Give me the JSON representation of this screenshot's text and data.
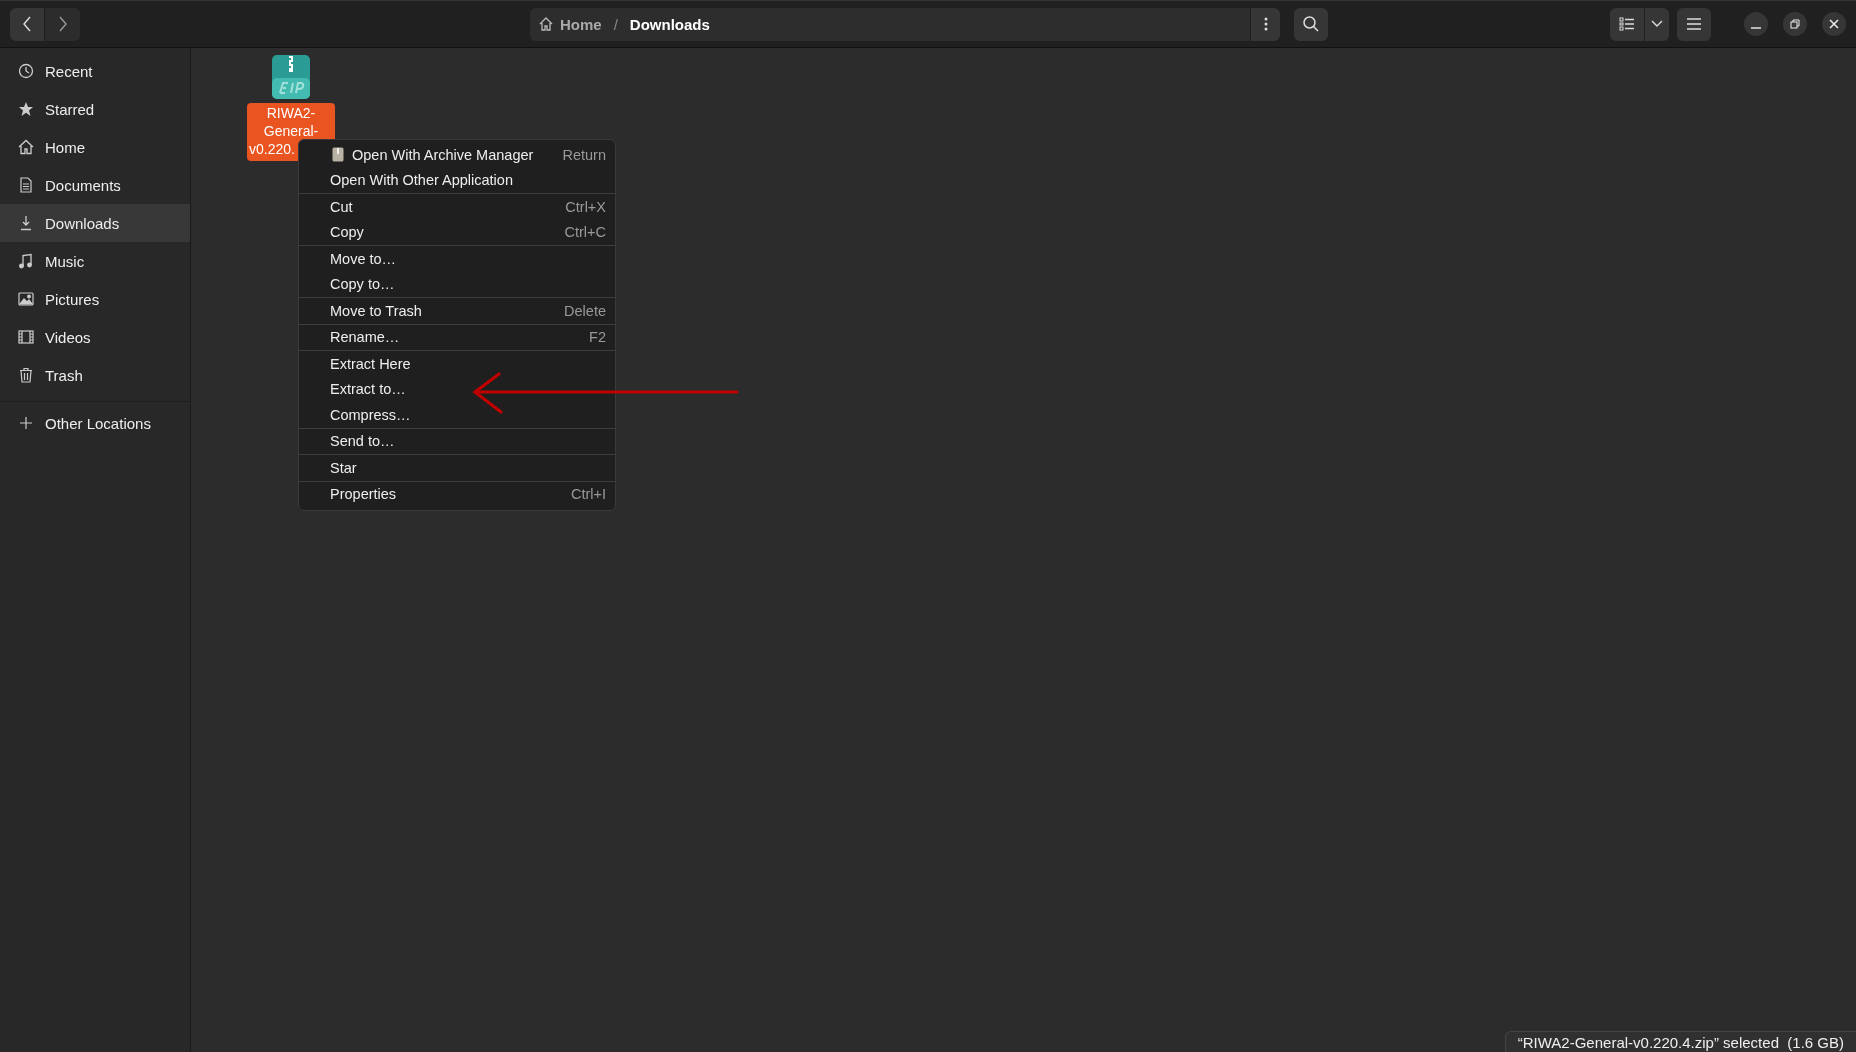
{
  "path_bar": {
    "crumbs": [
      {
        "label": "Home",
        "kind": "home"
      },
      {
        "label": "Downloads",
        "kind": "current",
        "separator": "/"
      }
    ]
  },
  "sidebar": {
    "items": [
      {
        "label": "Recent",
        "kind": "clock",
        "selected": false
      },
      {
        "label": "Starred",
        "kind": "star",
        "selected": false
      },
      {
        "label": "Home",
        "kind": "home",
        "selected": false
      },
      {
        "label": "Documents",
        "kind": "doc",
        "selected": false
      },
      {
        "label": "Downloads",
        "kind": "download",
        "selected": true
      },
      {
        "label": "Music",
        "kind": "music",
        "selected": false
      },
      {
        "label": "Pictures",
        "kind": "pictures",
        "selected": false
      },
      {
        "label": "Videos",
        "kind": "film",
        "selected": false
      },
      {
        "label": "Trash",
        "kind": "trash",
        "selected": false
      }
    ],
    "other": {
      "label": "Other Locations"
    }
  },
  "files": [
    {
      "label_lines": [
        "RIWA2-",
        "General-",
        "v0.220."
      ],
      "selected": true
    }
  ],
  "context_menu": {
    "groups": [
      [
        {
          "label": "Open With Archive Manager",
          "shortcut": "Return",
          "kind": "app"
        },
        {
          "label": "Open With Other Application",
          "kind": "plain"
        }
      ],
      [
        {
          "label": "Cut",
          "shortcut": "Ctrl+X",
          "kind": "plain"
        },
        {
          "label": "Copy",
          "shortcut": "Ctrl+C",
          "kind": "plain"
        }
      ],
      [
        {
          "label": "Move to…",
          "kind": "plain"
        },
        {
          "label": "Copy to…",
          "kind": "plain"
        }
      ],
      [
        {
          "label": "Move to Trash",
          "shortcut": "Delete",
          "kind": "plain"
        }
      ],
      [
        {
          "label": "Rename…",
          "shortcut": "F2",
          "kind": "plain"
        }
      ],
      [
        {
          "label": "Extract Here",
          "kind": "plain"
        },
        {
          "label": "Extract to…",
          "kind": "plain"
        },
        {
          "label": "Compress…",
          "kind": "plain"
        }
      ],
      [
        {
          "label": "Send to…",
          "kind": "plain"
        }
      ],
      [
        {
          "label": "Star",
          "kind": "plain"
        }
      ],
      [
        {
          "label": "Properties",
          "shortcut": "Ctrl+I",
          "kind": "plain"
        }
      ]
    ]
  },
  "status_bar": {
    "text": "“RIWA2-General-v0.220.4.zip” selected  (1.6 GB)"
  }
}
